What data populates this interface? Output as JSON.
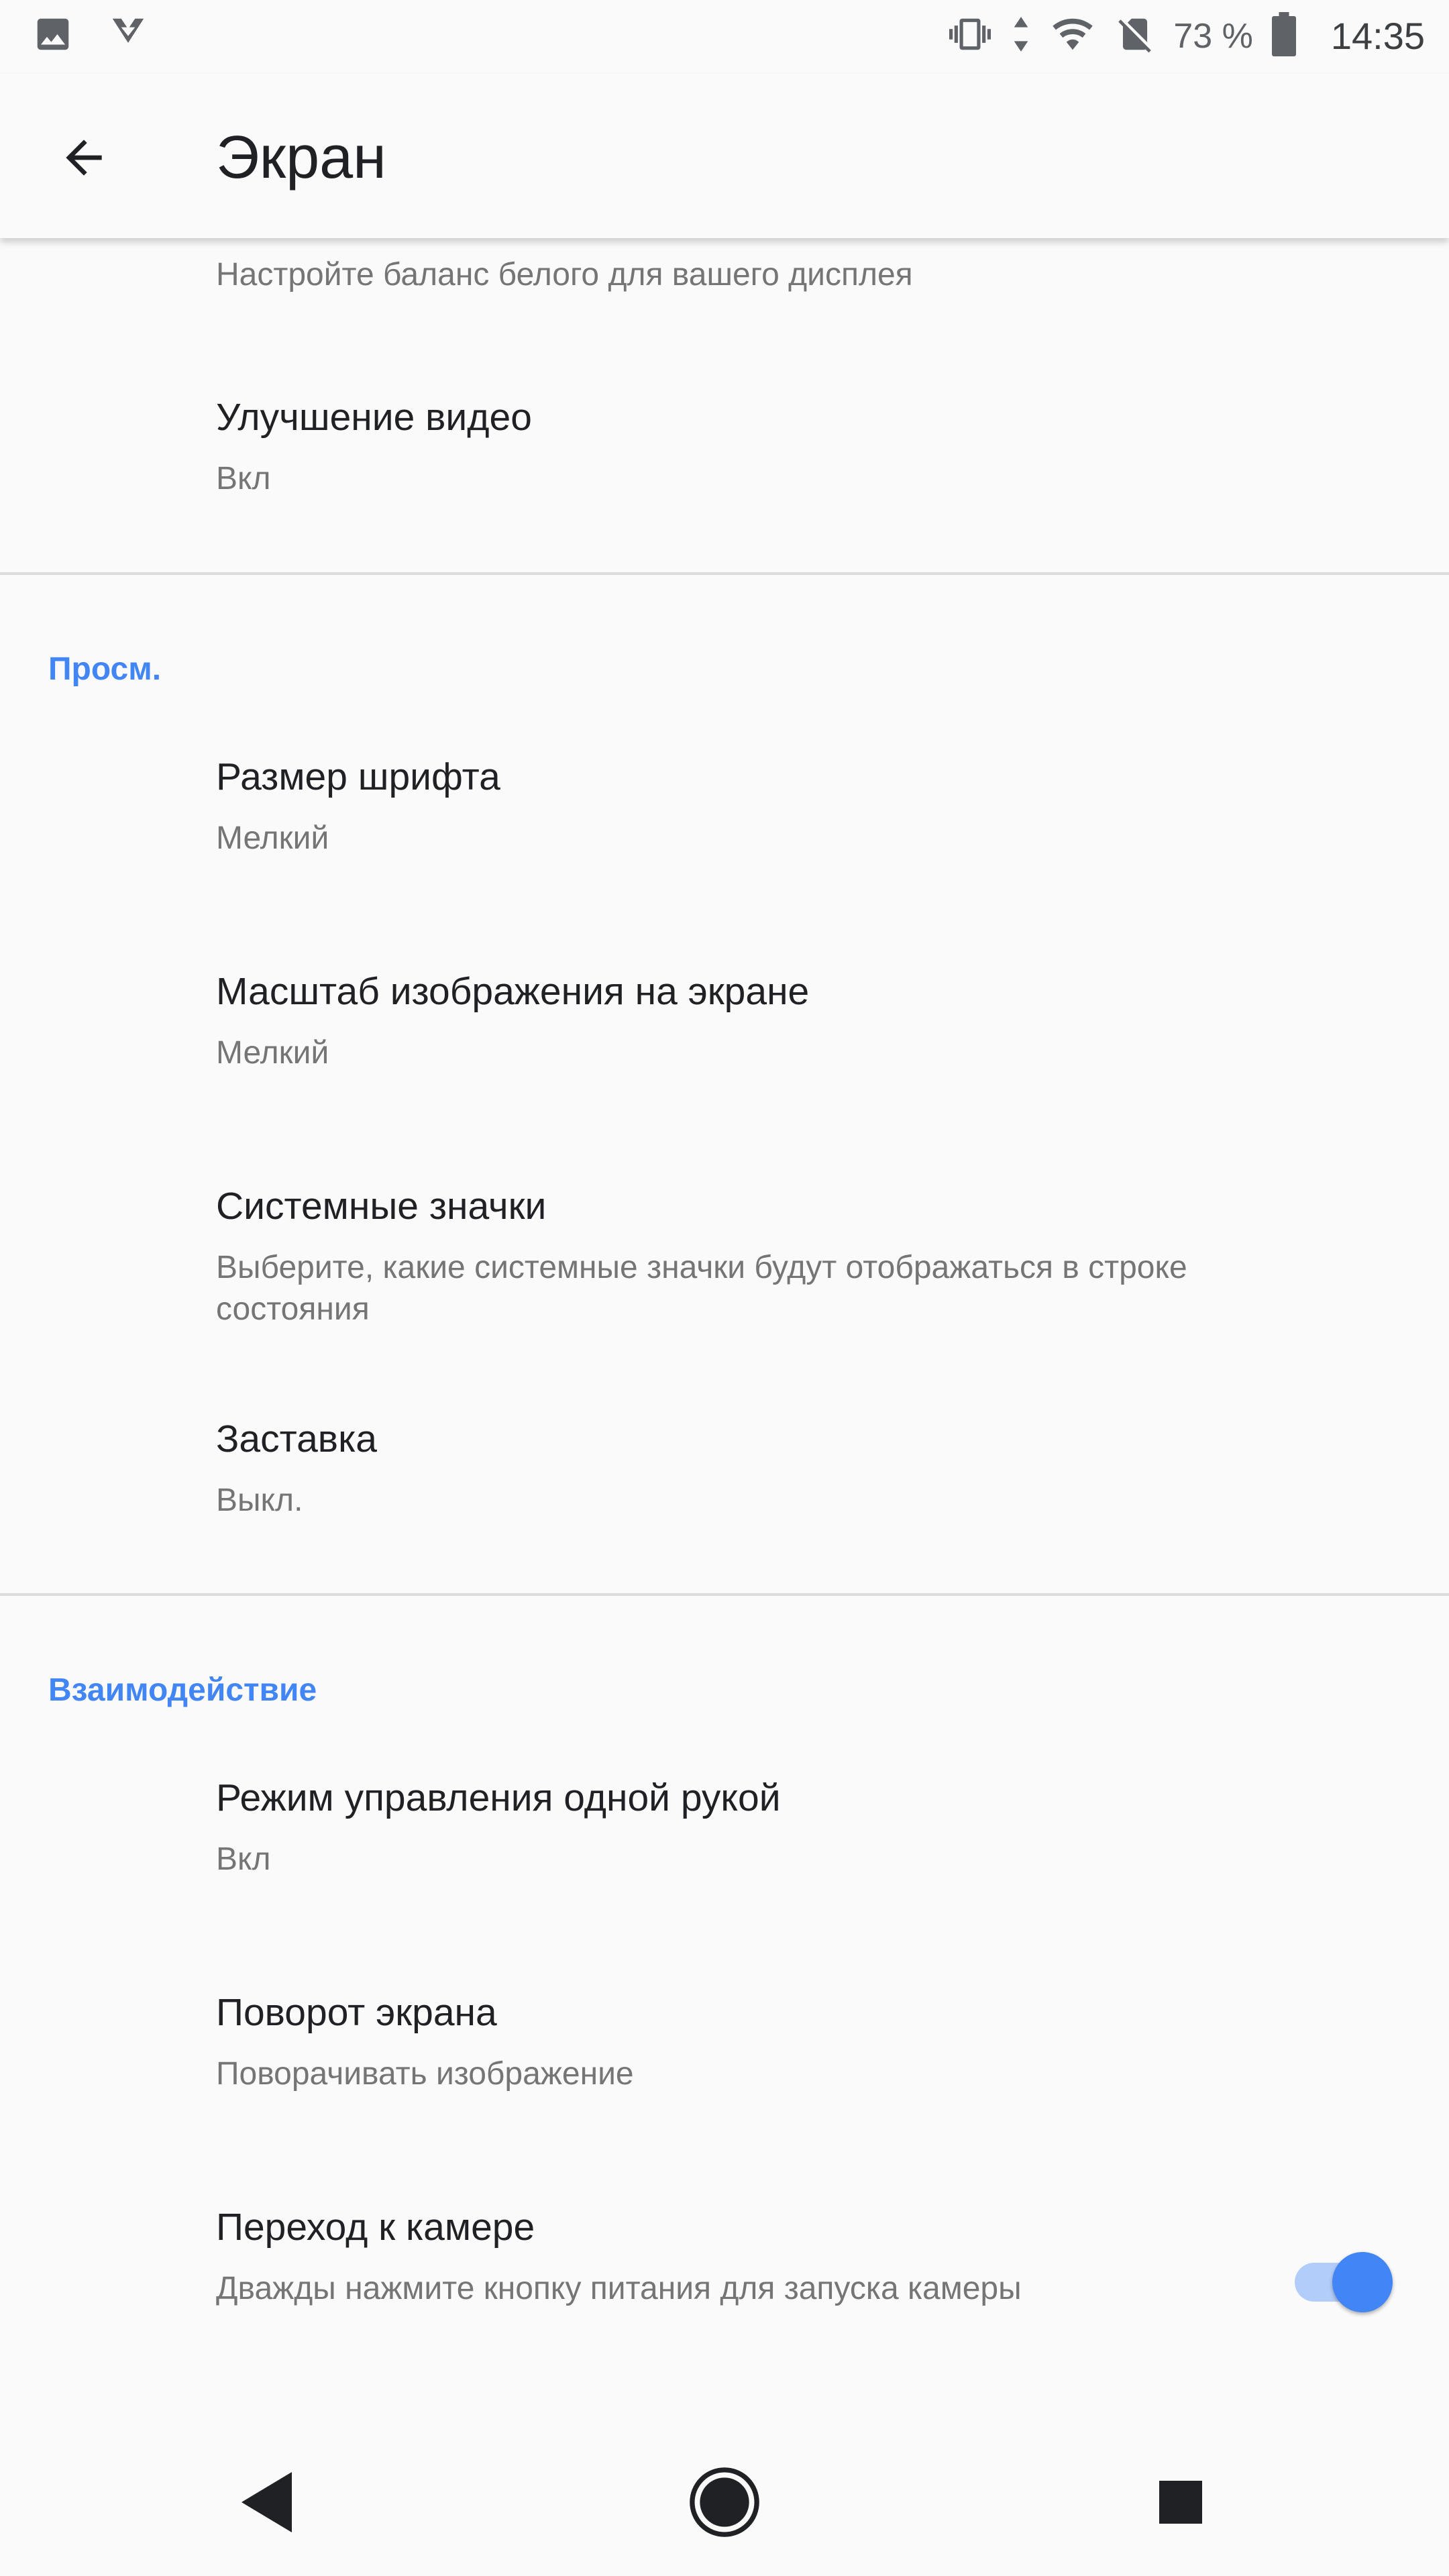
{
  "status_bar": {
    "battery_percent": "73 %",
    "time": "14:35",
    "icons": [
      "image-icon",
      "app-notification-icon",
      "vibrate-icon",
      "data-arrows-icon",
      "wifi-icon",
      "no-sim-icon",
      "battery-icon"
    ]
  },
  "header": {
    "title": "Экран"
  },
  "top_item": {
    "subtitle": "Настройте баланс белого для вашего дисплея"
  },
  "items_display": [
    {
      "title": "Улучшение видео",
      "subtitle": "Вкл"
    }
  ],
  "section_view": {
    "label": "Просм.",
    "items": [
      {
        "title": "Размер шрифта",
        "subtitle": "Мелкий"
      },
      {
        "title": "Масштаб изображения на экране",
        "subtitle": "Мелкий"
      },
      {
        "title": "Системные значки",
        "subtitle": "Выберите, какие системные значки будут отображаться в строке состояния"
      },
      {
        "title": "Заставка",
        "subtitle": "Выкл."
      }
    ]
  },
  "section_interaction": {
    "label": "Взаимодействие",
    "items": [
      {
        "title": "Режим управления одной рукой",
        "subtitle": "Вкл"
      },
      {
        "title": "Поворот экрана",
        "subtitle": "Поворачивать изображение"
      },
      {
        "title": "Переход к камере",
        "subtitle": "Дважды нажмите кнопку питания для запуска камеры",
        "toggle_on": true
      }
    ]
  },
  "colors": {
    "accent": "#4285f4",
    "background": "#fafafa",
    "primary_text": "#202124",
    "secondary_text": "#757575"
  },
  "nav_bar": {
    "icons": [
      "back-triangle-icon",
      "home-circle-icon",
      "recents-square-icon"
    ]
  }
}
